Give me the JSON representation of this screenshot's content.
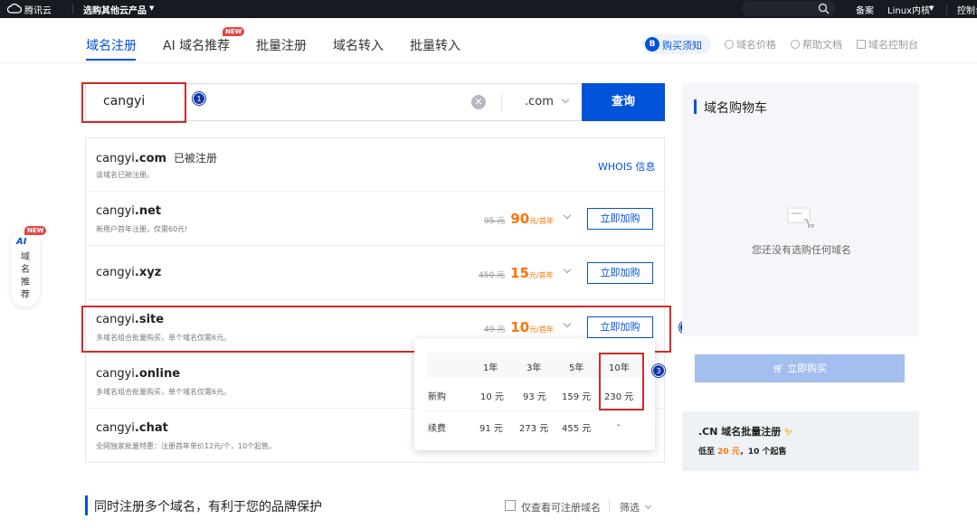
{
  "topbar": {
    "brand": "腾讯云",
    "products": "选购其他云产品",
    "beian": "备案",
    "region": "Linux内核",
    "console": "控制台"
  },
  "nav": {
    "tabs": [
      "域名注册",
      "AI 域名推荐",
      "批量注册",
      "域名转入",
      "批量转入"
    ],
    "new_badge": "NEW",
    "buy_notice": "购买须知",
    "links": [
      "域名价格",
      "帮助文档",
      "域名控制台"
    ]
  },
  "search": {
    "query": "cangyi",
    "tld": ".com",
    "button": "查询",
    "step1": "1",
    "step2": "2",
    "step3": "3"
  },
  "results": [
    {
      "name": "cangyi",
      "suffix": ".com",
      "status": "已被注册",
      "note": "该域名已被注册。",
      "whois": "WHOIS 信息"
    },
    {
      "name": "cangyi",
      "suffix": ".net",
      "note": "新用户首年注册，仅需60元!",
      "old_price": "95 元",
      "price": "90",
      "unit": "元/首年",
      "action": "立即加购"
    },
    {
      "name": "cangyi",
      "suffix": ".xyz",
      "note": "",
      "old_price": "450 元",
      "price": "15",
      "unit": "元/首年",
      "action": "立即加购"
    },
    {
      "name": "cangyi",
      "suffix": ".site",
      "note": "多域名组合批量购买，单个域名仅需6元。",
      "old_price": "49 元",
      "price": "10",
      "unit": "元/首年",
      "action": "立即加购"
    },
    {
      "name": "cangyi",
      "suffix": ".online",
      "note": "多域名组合批量购买，单个域名仅需6元。"
    },
    {
      "name": "cangyi",
      "suffix": ".chat",
      "note": "全网独家批量特惠：注册首年单价12元/个，10个起售。"
    }
  ],
  "price_popup": {
    "years": [
      "1年",
      "3年",
      "5年",
      "10年"
    ],
    "rows": [
      {
        "label": "新购",
        "values": [
          "10 元",
          "93 元",
          "159 元",
          "230 元"
        ]
      },
      {
        "label": "续费",
        "values": [
          "91 元",
          "273 元",
          "455 元",
          "-"
        ]
      }
    ]
  },
  "cart": {
    "title": "域名购物车",
    "empty_text": "您还没有选购任何域名",
    "buy_button": "立即购买"
  },
  "promo": {
    "title": ".CN 域名批量注册",
    "line_prefix": "低至",
    "price": "20 元",
    "line_suffix": "，10 个起售"
  },
  "side_float": {
    "badge": "NEW",
    "ai": "AI",
    "label": "域名推荐"
  },
  "bottom": {
    "title": "同时注册多个域名，有利于您的品牌保护",
    "checkbox_label": "仅查看可注册域名",
    "filter": "筛选"
  },
  "colors": {
    "accent": "#0052d9",
    "price": "#ff7200",
    "highlight_box": "#d12a2a"
  }
}
